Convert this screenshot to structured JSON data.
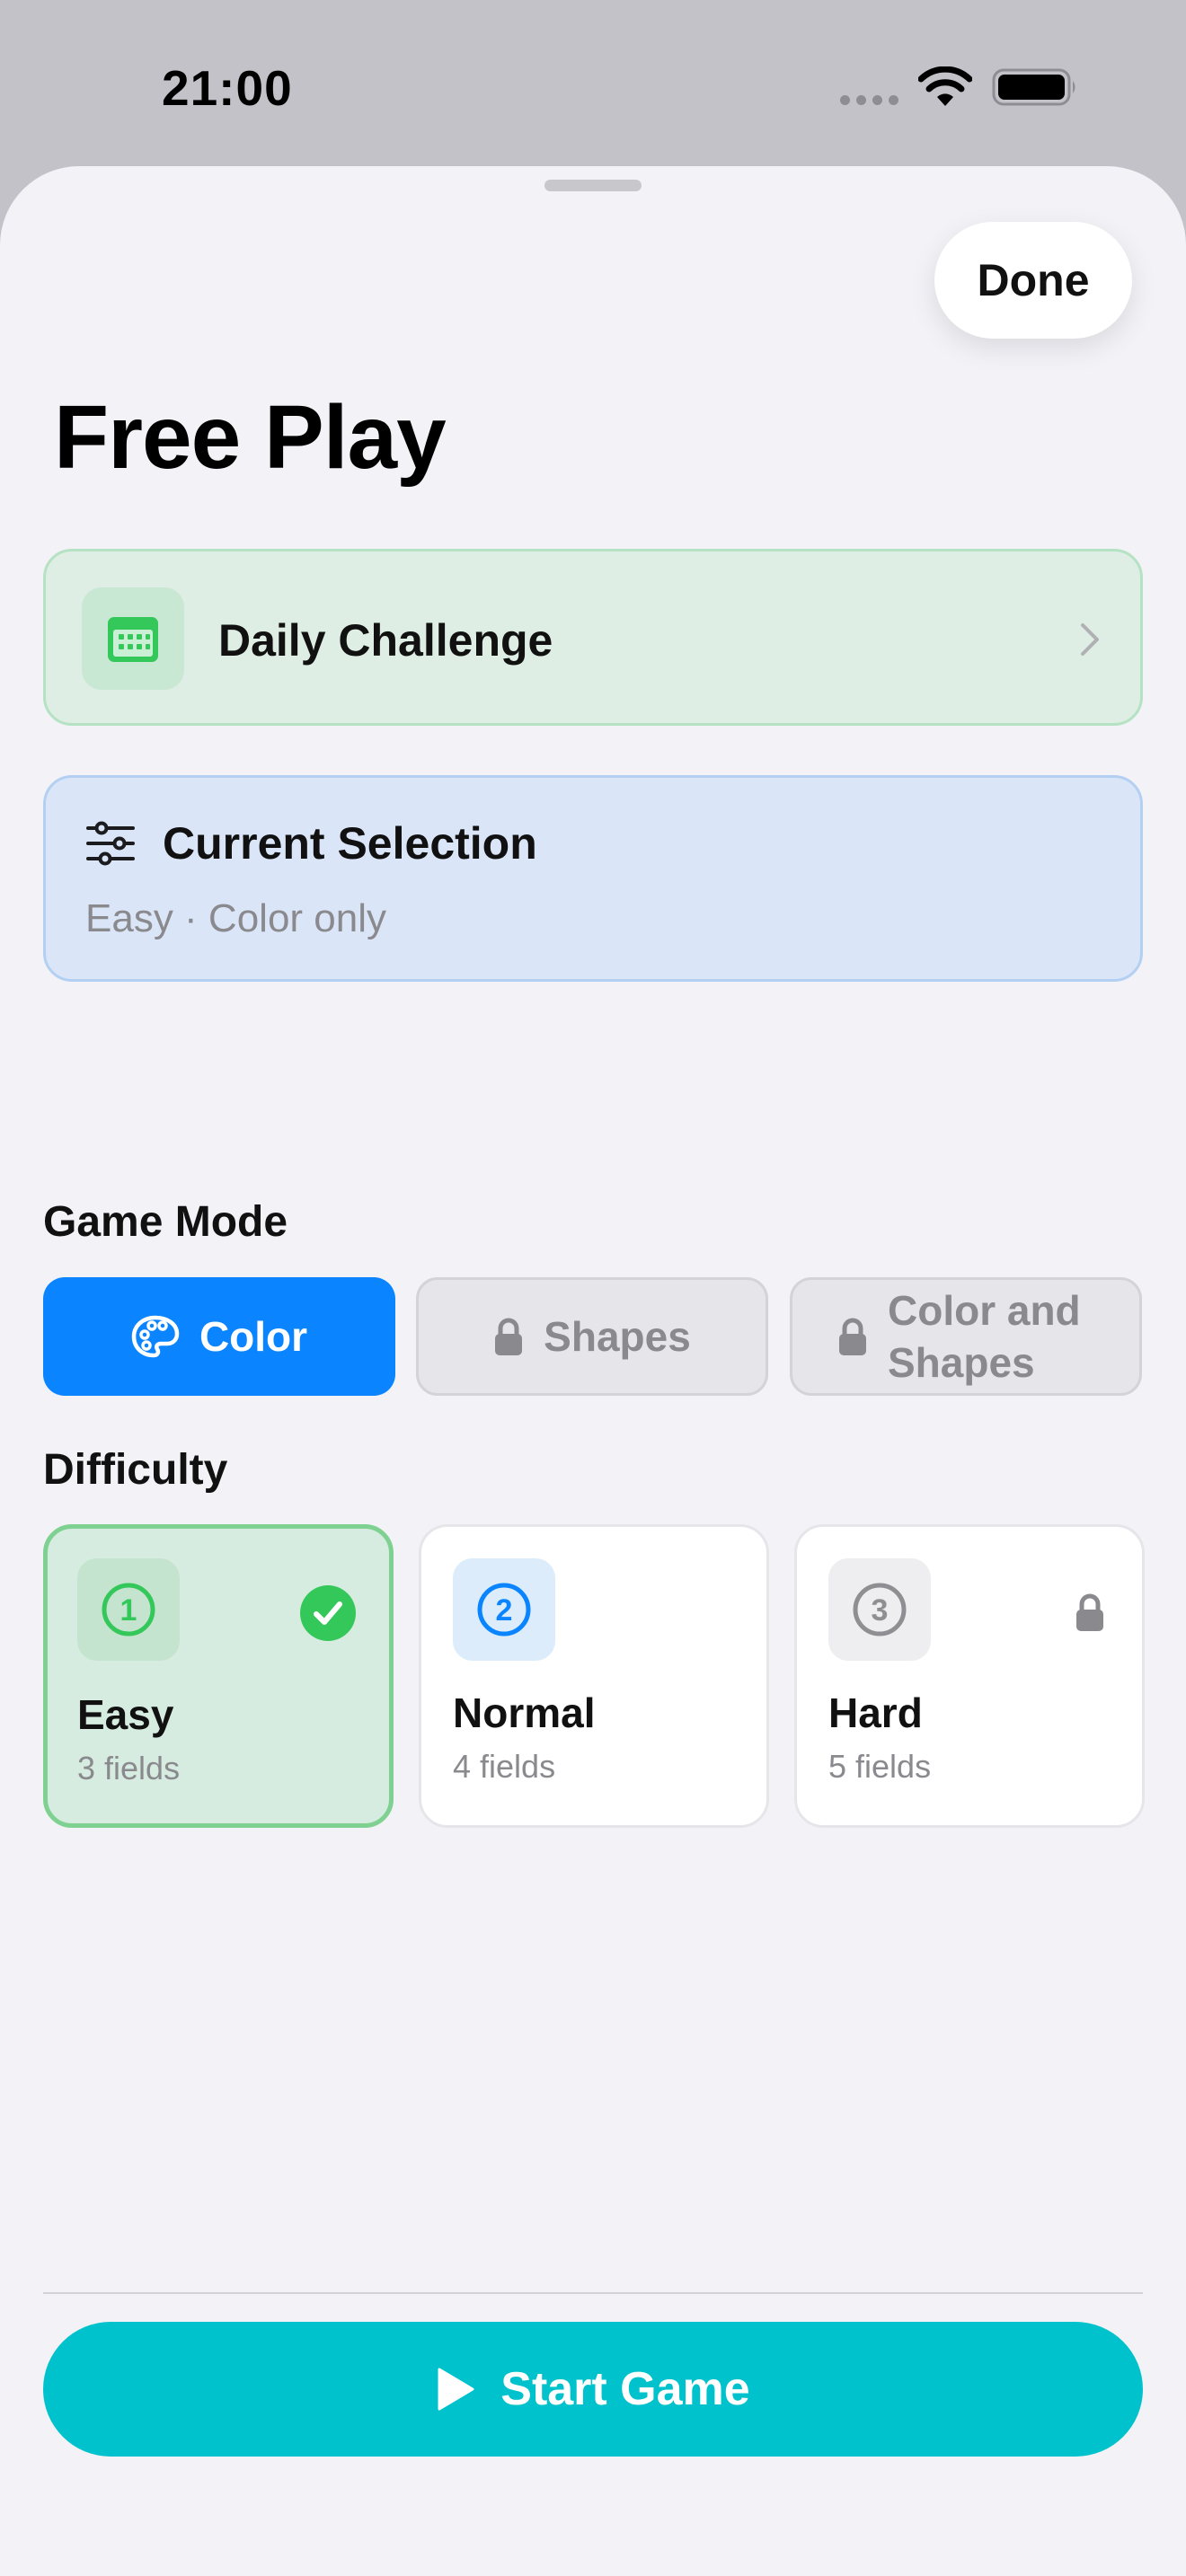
{
  "status_bar": {
    "time": "21:00"
  },
  "header": {
    "done_label": "Done",
    "title": "Free Play"
  },
  "daily_challenge": {
    "label": "Daily Challenge",
    "accent": "#34c759"
  },
  "current_selection": {
    "title": "Current Selection",
    "summary": "Easy · Color only"
  },
  "game_mode": {
    "section_title": "Game Mode",
    "options": [
      {
        "label": "Color",
        "selected": true,
        "locked": false,
        "icon": "palette-icon"
      },
      {
        "label": "Shapes",
        "selected": false,
        "locked": true,
        "icon": "lock-icon"
      },
      {
        "label": "Color and Shapes",
        "selected": false,
        "locked": true,
        "icon": "lock-icon"
      }
    ]
  },
  "difficulty": {
    "section_title": "Difficulty",
    "options": [
      {
        "number": "1",
        "name": "Easy",
        "fields": "3 fields",
        "selected": true,
        "locked": false,
        "color": "#34c759"
      },
      {
        "number": "2",
        "name": "Normal",
        "fields": "4 fields",
        "selected": false,
        "locked": false,
        "color": "#0a84ff"
      },
      {
        "number": "3",
        "name": "Hard",
        "fields": "5 fields",
        "selected": false,
        "locked": true,
        "color": "#8e8e93"
      }
    ]
  },
  "footer": {
    "start_label": "Start Game",
    "accent": "#00c2cc"
  }
}
